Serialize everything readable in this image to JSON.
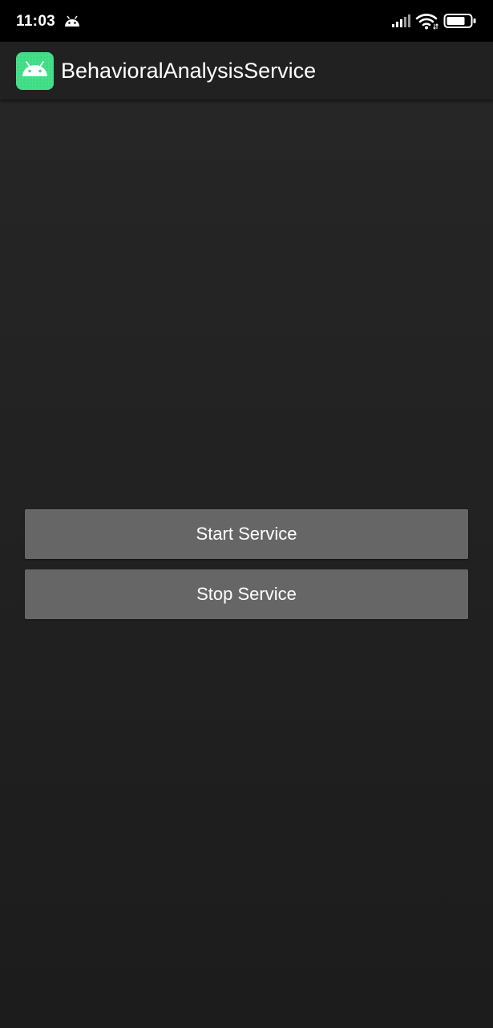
{
  "status_bar": {
    "time": "11:03",
    "icons": [
      "android-notification-icon",
      "signal-icon",
      "wifi-icon",
      "battery-icon"
    ]
  },
  "app_bar": {
    "title": "BehavioralAnalysisService",
    "icon": "android-app-icon"
  },
  "main": {
    "start_button_label": "Start Service",
    "stop_button_label": "Stop Service"
  },
  "colors": {
    "status_bar_bg": "#000000",
    "app_bar_bg": "#212121",
    "background": "#1e1e1e",
    "button_bg": "#666666",
    "app_icon_green": "#3ddc84",
    "text": "#ffffff"
  }
}
